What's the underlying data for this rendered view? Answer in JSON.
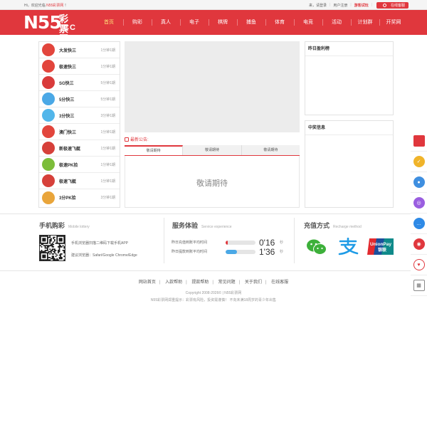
{
  "topbar": {
    "greeting": "Hi，欢迎光临",
    "site_name": "N55彩票网",
    "greeting_end": "！",
    "login": "来，请登录",
    "register": "用户注册",
    "demo": "游客试玩",
    "service": "在线客服"
  },
  "logo": {
    "main": "N55",
    "sub": "彩票网",
    "domain": ".CC"
  },
  "nav": [
    "首页",
    "购彩",
    "真人",
    "电子",
    "棋牌",
    "捕鱼",
    "体育",
    "电竞",
    "活动",
    "计划群",
    "开奖网"
  ],
  "lotteries": [
    {
      "name": "大发快三",
      "period": "1分钟1期",
      "icon": "dice-icon",
      "color": "#e2453c"
    },
    {
      "name": "极速快三",
      "period": "1分钟1期",
      "icon": "dice-icon",
      "color": "#e2453c"
    },
    {
      "name": "SG快三",
      "period": "5分钟1期",
      "icon": "sg-icon",
      "color": "#d93b3b"
    },
    {
      "name": "5分快三",
      "period": "5分钟1期",
      "icon": "clock-icon",
      "color": "#4aa8e6"
    },
    {
      "name": "3分快三",
      "period": "3分钟1期",
      "icon": "clock-icon",
      "color": "#52b6ea"
    },
    {
      "name": "澳门快三",
      "period": "1分钟1期",
      "icon": "dice-icon",
      "color": "#e2453c"
    },
    {
      "name": "新极速飞艇",
      "period": "1分钟1期",
      "icon": "boat-icon",
      "color": "#d6403a"
    },
    {
      "name": "极速PK拾",
      "period": "1分钟1期",
      "icon": "race-icon",
      "color": "#7cbd3a"
    },
    {
      "name": "极速飞艇",
      "period": "1分钟1期",
      "icon": "boat-icon",
      "color": "#d6403a"
    },
    {
      "name": "3分PK拾",
      "period": "3分钟1期",
      "icon": "race-icon",
      "color": "#e9a53b"
    }
  ],
  "notice_label": "最新公告:",
  "tabs": [
    "敬请期待",
    "敬请期待",
    "敬请期待"
  ],
  "tab_placeholder": "敬请期待",
  "panels": {
    "yesterday": "昨日盈利榜",
    "winners": "中奖信息"
  },
  "mobile": {
    "title": "手机购彩",
    "title_en": "Mobile lottery",
    "line1": "手机浏览器扫描二维码下载手机APP",
    "line2": "建议浏览器：Safari/Google Chrome/Edge"
  },
  "service": {
    "title": "服务体验",
    "title_en": "Service experience",
    "rows": [
      {
        "label": "昨日充值到账平均时间",
        "value": "0'16",
        "unit": "秒",
        "fill": 0.08,
        "color": "#e0373d"
      },
      {
        "label": "昨日提款到账平均时间",
        "value": "1'36",
        "unit": "秒",
        "fill": 0.38,
        "color": "#4aa8e6"
      }
    ]
  },
  "recharge": {
    "title": "充值方式",
    "title_en": "Recharge method",
    "methods": [
      "wechat-icon",
      "alipay-icon",
      "unionpay-icon"
    ],
    "unionpay_text": "UnionPay",
    "unionpay_cn": "银联"
  },
  "footer": {
    "links": [
      "网站首页",
      "入款帮助",
      "提款帮助",
      "常见问题",
      "关于我们",
      "在线客服"
    ],
    "copyright": "Copyright 2008-2026© | N55彩票网",
    "warning": "N55彩票网郑重提示：彩票有风险，投资需谨慎！ 不向未满18周岁的青少年出售"
  },
  "colors": {
    "brand": "#e0373d",
    "accent": "#ffe57a"
  }
}
